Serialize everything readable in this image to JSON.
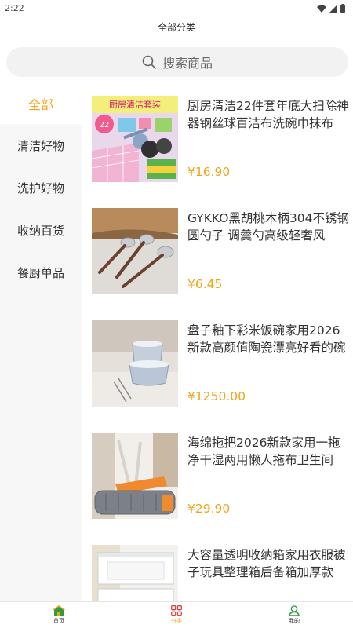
{
  "status_bar": {
    "time": "2:22"
  },
  "header": {
    "title": "全部分类"
  },
  "search": {
    "placeholder": "搜索商品"
  },
  "sidebar": {
    "items": [
      {
        "label": "全部",
        "active": true
      },
      {
        "label": "清洁好物"
      },
      {
        "label": "洗护好物"
      },
      {
        "label": "收纳百货"
      },
      {
        "label": "餐厨单品"
      }
    ]
  },
  "products": [
    {
      "title": "厨房清洁22件套年底大扫除神器钢丝球百洁布洗碗巾抹布",
      "price": "¥16.90",
      "thumb_text": "厨房清洁套装"
    },
    {
      "title": "GYKKO黑胡桃木柄304不锈钢圆勺子 调羹勺高级轻奢风",
      "price": "¥6.45"
    },
    {
      "title": "盘子釉下彩米饭碗家用2026新款高颜值陶瓷漂亮好看的碗",
      "price": "¥1250.00"
    },
    {
      "title": "海绵拖把2026新款家用一拖净干湿两用懒人拖布卫生间",
      "price": "¥29.90"
    },
    {
      "title": "大容量透明收纳箱家用衣服被子玩具整理箱后备箱加厚款",
      "price": ""
    }
  ],
  "tab_bar": {
    "tabs": [
      {
        "label": "首页",
        "icon": "home-icon"
      },
      {
        "label": "分类",
        "icon": "category-icon",
        "active": true
      },
      {
        "label": "我的",
        "icon": "profile-icon"
      }
    ]
  },
  "colors": {
    "accent": "#f0a418",
    "home_green": "#2e9c45"
  }
}
